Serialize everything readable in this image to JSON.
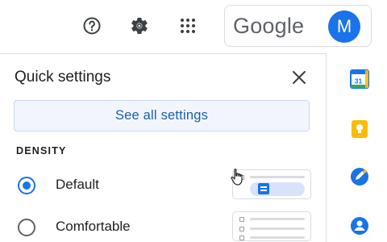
{
  "header": {
    "help_icon": "help-circle",
    "settings_icon": "gear",
    "apps_icon": "apps-grid",
    "brand": "Google",
    "avatar_initial": "M",
    "avatar_color": "#1a73e8"
  },
  "quick_settings": {
    "title": "Quick settings",
    "close_icon": "close-x",
    "see_all_label": "See all settings",
    "density": {
      "section_label": "DENSITY",
      "options": [
        {
          "label": "Default",
          "selected": true
        },
        {
          "label": "Comfortable",
          "selected": false
        }
      ]
    }
  },
  "side_rail": {
    "calendar_day": "31",
    "apps": [
      "calendar",
      "keep",
      "tasks",
      "contacts"
    ]
  },
  "colors": {
    "accent": "#1a73e8",
    "keep": "#fbbc04",
    "link": "#1a5fb4"
  }
}
